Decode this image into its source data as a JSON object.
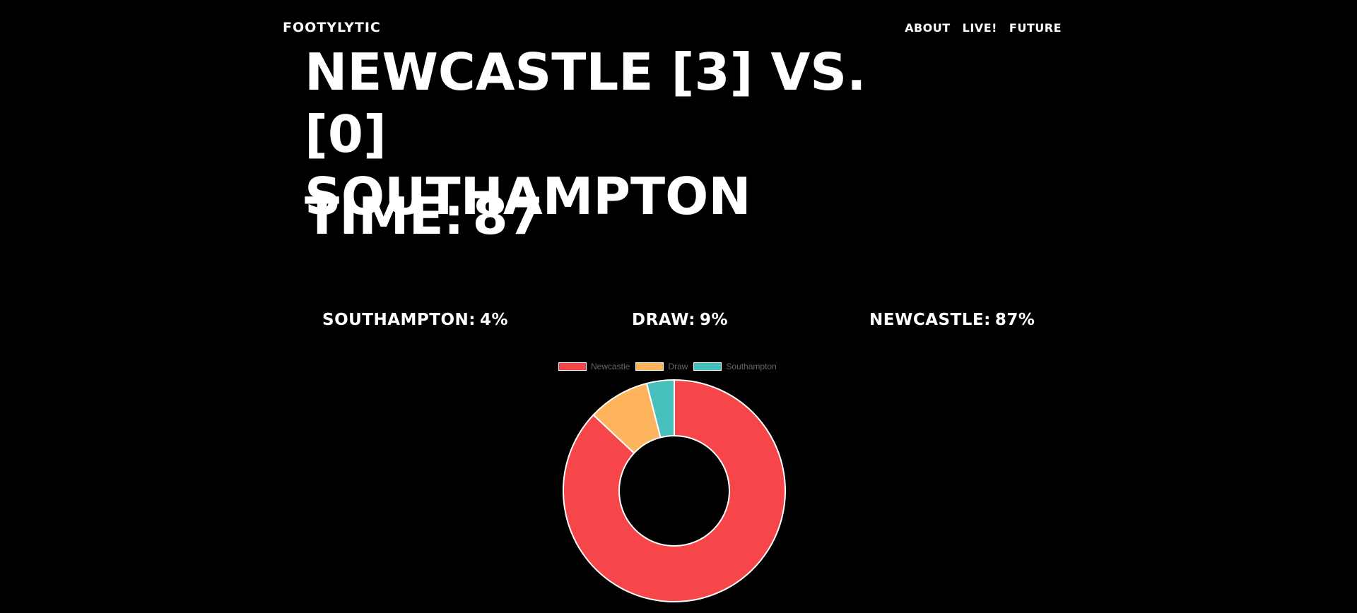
{
  "header": {
    "brand": "FOOTYLYTIC",
    "nav": [
      {
        "label": "ABOUT"
      },
      {
        "label": "LIVE!"
      },
      {
        "label": "FUTURE"
      }
    ]
  },
  "match": {
    "home_team": "NEWCASTLE",
    "home_score": "[3]",
    "vs": "VS.",
    "away_score": "[0]",
    "away_team": "SOUTHAMPTON",
    "time_label": "TIME:",
    "time_value": "87"
  },
  "probabilities": {
    "away": {
      "label": "SOUTHAMPTON:",
      "value": "4%"
    },
    "draw": {
      "label": "DRAW:",
      "value": "9%"
    },
    "home": {
      "label": "NEWCASTLE:",
      "value": "87%"
    }
  },
  "chart_data": {
    "type": "pie",
    "variant": "doughnut",
    "categories": [
      "Newcastle",
      "Draw",
      "Southampton"
    ],
    "values": [
      87,
      9,
      4
    ],
    "colors": [
      "#F7464A",
      "#FDB45C",
      "#46BFBD"
    ],
    "legend": "top"
  }
}
